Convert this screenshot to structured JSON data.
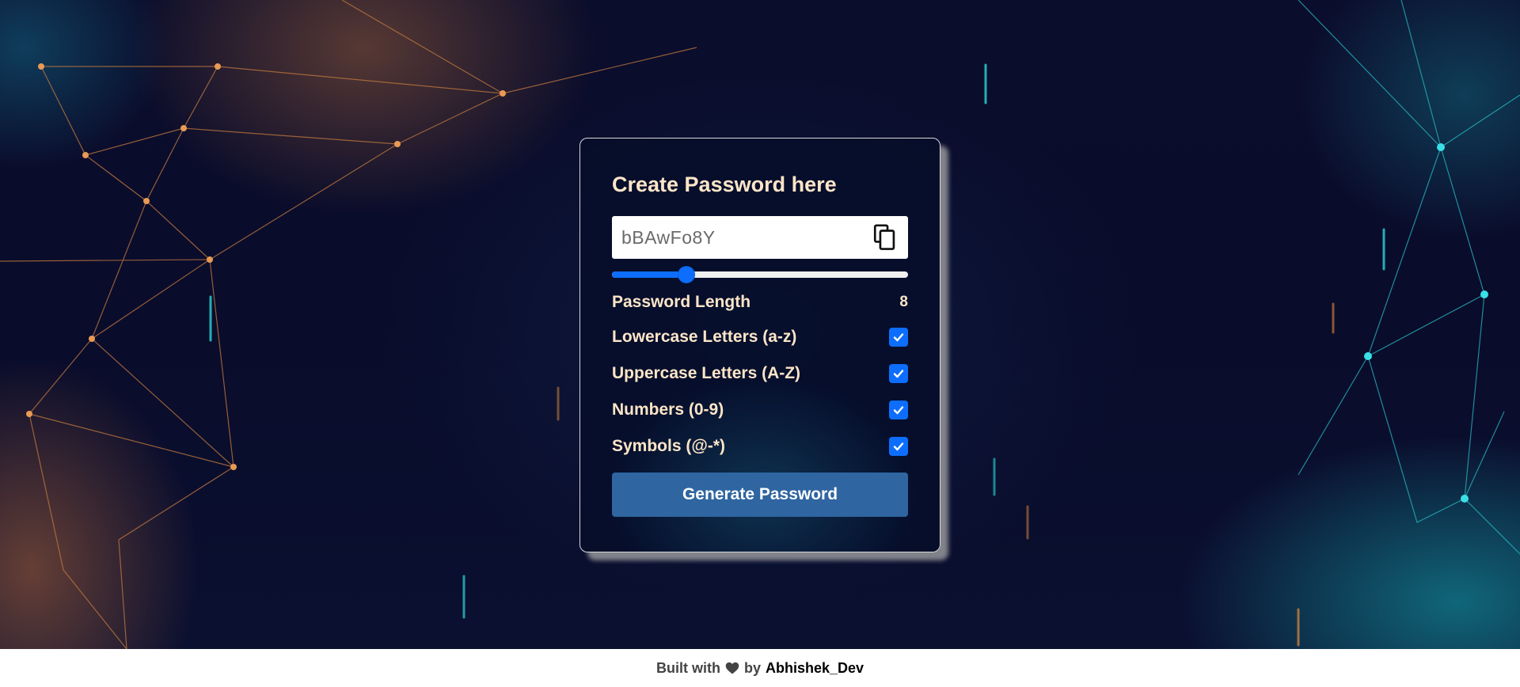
{
  "card": {
    "title": "Create Password here",
    "password_value": "bBAwFo8Y",
    "copy_icon": "copy-icon",
    "slider": {
      "value": 8,
      "min": 4,
      "max": 30,
      "fill_fraction": 0.25
    },
    "length_label": "Password Length",
    "length_value": "8",
    "options": [
      {
        "label": "Lowercase Letters (a-z)",
        "checked": true
      },
      {
        "label": "Uppercase Letters (A-Z)",
        "checked": true
      },
      {
        "label": "Numbers (0-9)",
        "checked": true
      },
      {
        "label": "Symbols (@-*)",
        "checked": true
      }
    ],
    "generate_label": "Generate Password"
  },
  "footer": {
    "prefix": "Built with",
    "heart_icon": "heart-icon",
    "by": "by",
    "author": "Abhishek_Dev"
  },
  "colors": {
    "label": "#fde5c8",
    "accent": "#0d6efd",
    "button": "#2f65a1",
    "background": "#0a0c2b"
  }
}
